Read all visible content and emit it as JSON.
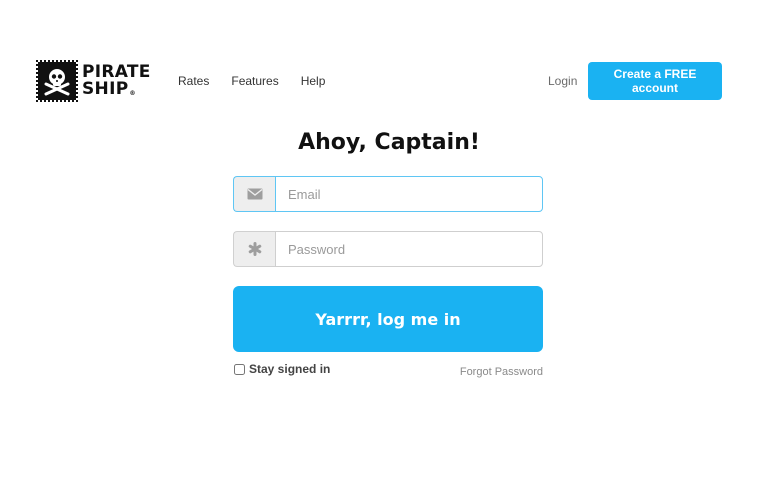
{
  "brand": {
    "line1": "PIRATE",
    "line2": "SHIP",
    "reg_mark": "®"
  },
  "nav": {
    "items": [
      {
        "label": "Rates"
      },
      {
        "label": "Features"
      },
      {
        "label": "Help"
      }
    ],
    "login_label": "Login",
    "create_account_label": "Create a FREE account"
  },
  "form": {
    "heading": "Ahoy, Captain!",
    "email": {
      "value": "",
      "placeholder": "Email",
      "icon": "envelope-icon"
    },
    "password": {
      "value": "",
      "placeholder": "Password",
      "icon": "asterisk-icon"
    },
    "submit_label": "Yarrrr, log me in",
    "stay_signed_in_label": "Stay signed in",
    "stay_signed_in_checked": false,
    "forgot_label": "Forgot Password"
  },
  "colors": {
    "accent": "#1ab2f2",
    "focus_border": "#5fc6f4"
  }
}
